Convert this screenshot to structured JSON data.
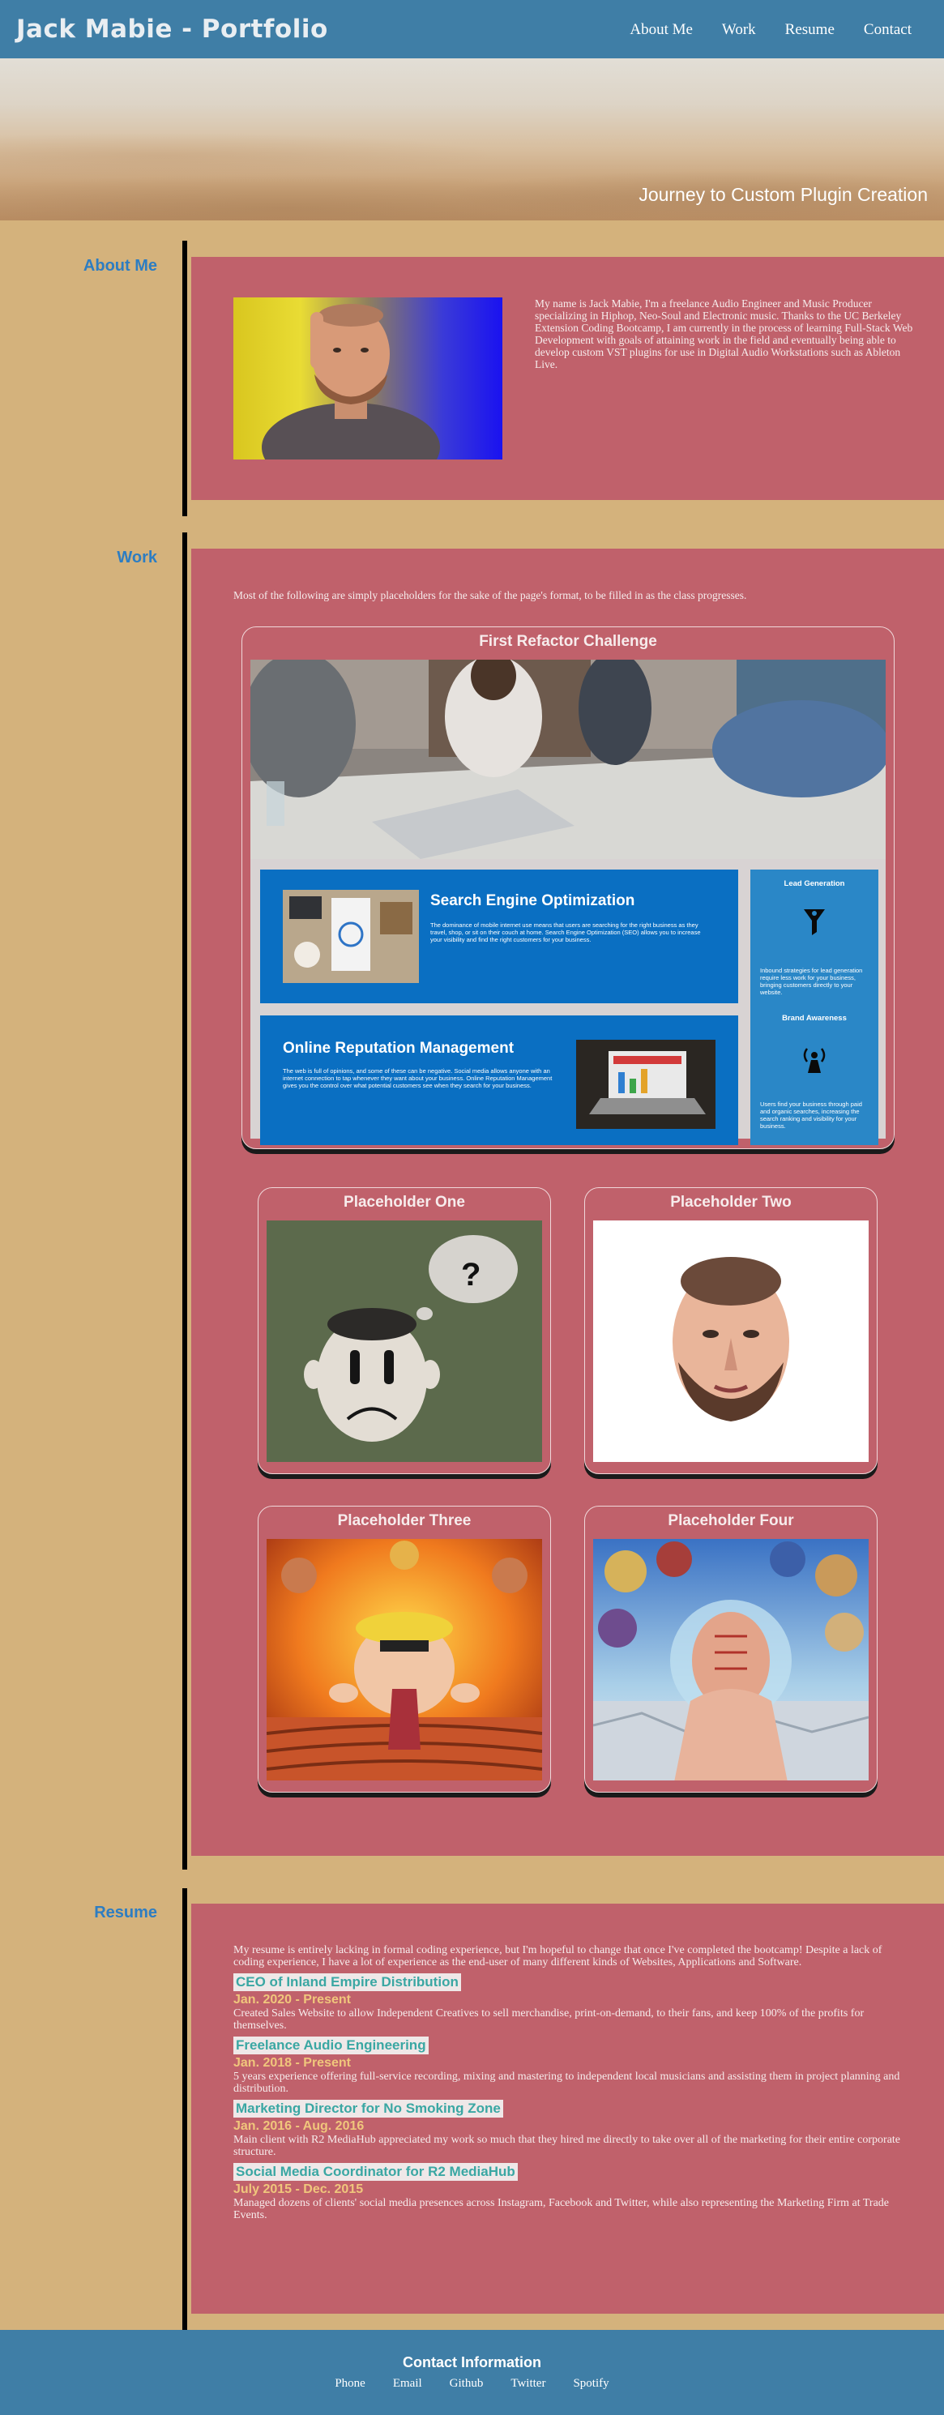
{
  "header": {
    "title": "Jack Mabie - Portfolio",
    "nav": [
      "About Me",
      "Work",
      "Resume",
      "Contact"
    ]
  },
  "hero": {
    "caption": "Journey to Custom Plugin Creation"
  },
  "about": {
    "label": "About Me",
    "text": "My name is Jack Mabie, I'm a freelance Audio Engineer and Music Producer specializing in Hiphop, Neo-Soul and Electronic music. Thanks to the UC Berkeley Extension Coding Bootcamp, I am currently in the process of learning Full-Stack Web Development with goals of attaining work in the field and eventually being able to develop custom VST plugins for use in Digital Audio Workstations such as Ableton Live."
  },
  "work": {
    "label": "Work",
    "intro": "Most of the following are simply placeholders for the sake of the page's format, to be filled in as the class progresses.",
    "featured": {
      "title": "First Refactor Challenge",
      "seo_title": "Search Engine Optimization",
      "seo_text": "The dominance of mobile internet use means that users are searching for the right business as they travel, shop, or sit on their couch at home. Search Engine Optimization (SEO) allows you to increase your visibility and find the right customers for your business.",
      "orm_title": "Online Reputation Management",
      "orm_text": "The web is full of opinions, and some of these can be negative. Social media allows anyone with an internet connection to tap whenever they want about your business. Online Reputation Management gives you the control over what potential customers see when they search for your business.",
      "side1_title": "Lead Generation",
      "side1_text": "Inbound strategies for lead generation require less work for your business, bringing customers directly to your website.",
      "side2_title": "Brand Awareness",
      "side2_text": "Users find your business through paid and organic searches, increasing the search ranking and visibility for your business."
    },
    "cards": [
      "Placeholder One",
      "Placeholder Two",
      "Placeholder Three",
      "Placeholder Four"
    ]
  },
  "resume": {
    "label": "Resume",
    "intro": "My resume is entirely lacking in formal coding experience, but I'm hopeful to change that once I've completed the bootcamp! Despite a lack of coding experience, I have a lot of experience as the end-user of many different kinds of Websites, Applications and Software.",
    "jobs": [
      {
        "title": "CEO of Inland Empire Distribution",
        "date": "Jan. 2020 - Present",
        "desc": "Created Sales Website to allow Independent Creatives to sell merchandise, print-on-demand, to their fans, and keep 100% of the profits for themselves."
      },
      {
        "title": "Freelance Audio Engineering",
        "date": "Jan. 2018 - Present",
        "desc": "5 years experience offering full-service recording, mixing and mastering to independent local musicians and assisting them in project planning and distribution."
      },
      {
        "title": "Marketing Director for No Smoking Zone",
        "date": "Jan. 2016 - Aug. 2016",
        "desc": "Main client with R2 MediaHub appreciated my work so much that they hired me directly to take over all of the marketing for their entire corporate structure."
      },
      {
        "title": "Social Media Coordinator for R2 MediaHub",
        "date": "July 2015 - Dec. 2015",
        "desc": "Managed dozens of clients' social media presences across Instagram, Facebook and Twitter, while also representing the Marketing Firm at Trade Events."
      }
    ]
  },
  "footer": {
    "title": "Contact Information",
    "links": [
      "Phone",
      "Email",
      "Github",
      "Twitter",
      "Spotify"
    ]
  }
}
